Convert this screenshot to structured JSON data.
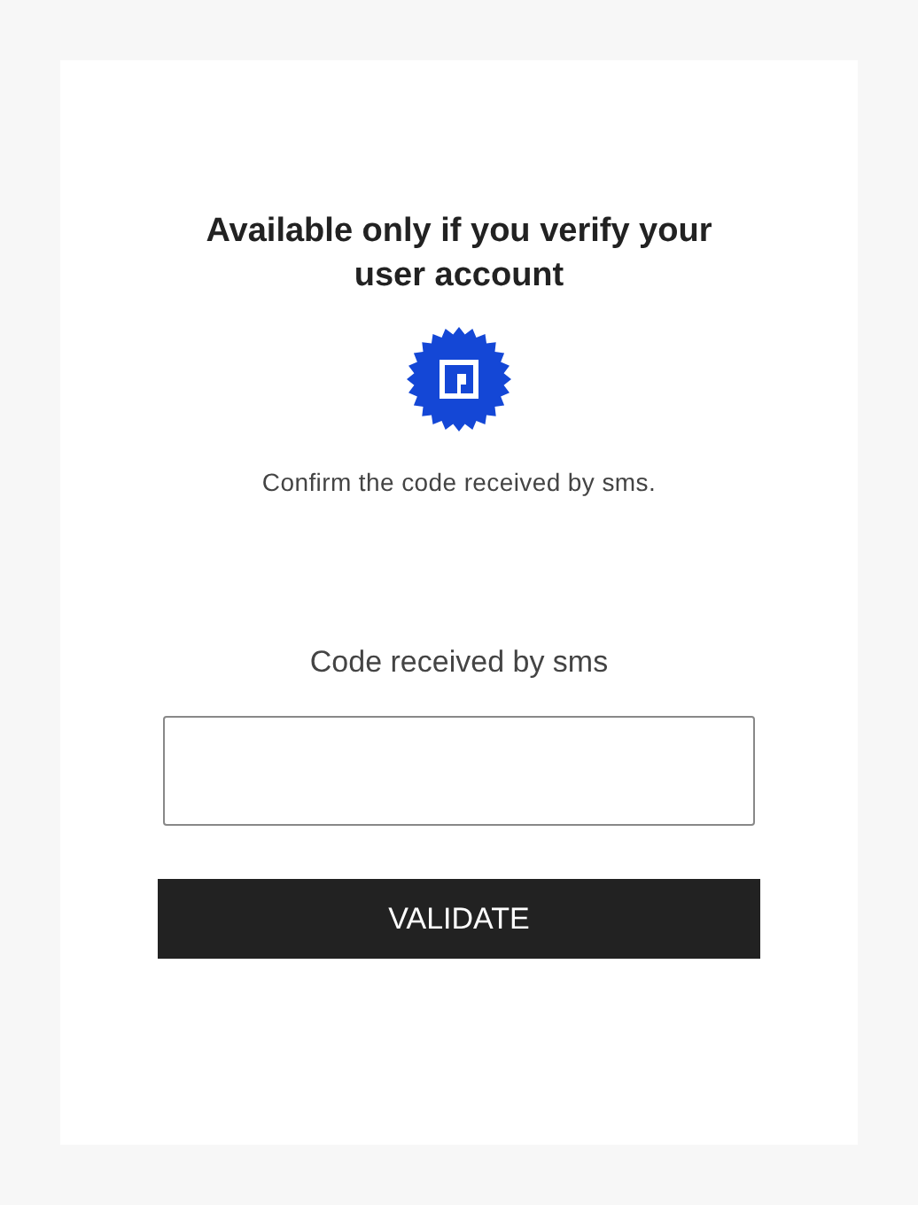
{
  "title": "Available only if you verify your user account",
  "instruction": "Confirm the code received by sms.",
  "code_field": {
    "label": "Code received by sms"
  },
  "validate_button": "VALIDATE"
}
